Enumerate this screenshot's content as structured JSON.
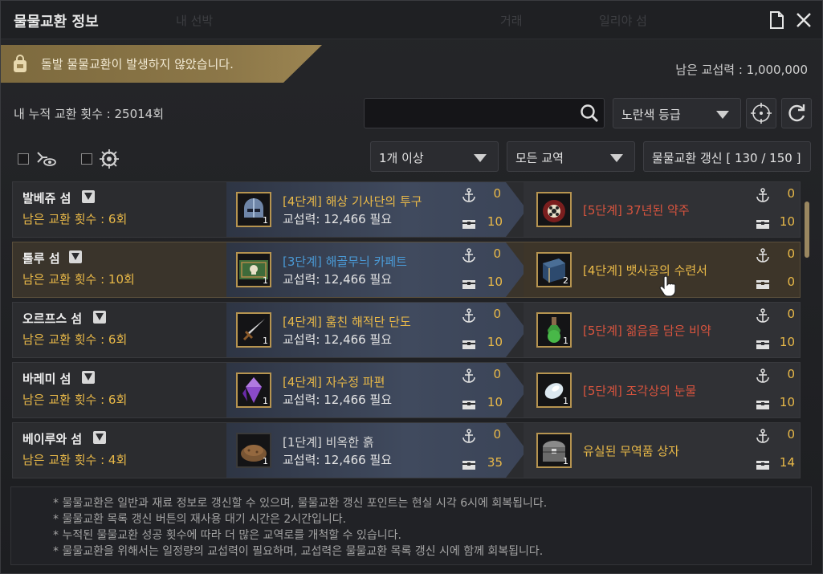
{
  "window": {
    "title": "물물교환 정보",
    "ghost_tabs": [
      "내 선박",
      "거래",
      "일리야 섬"
    ]
  },
  "banner": {
    "text": "돌발 물물교환이 발생하지 않았습니다."
  },
  "remaining_power": "남은 교섭력 : 1,000,000",
  "cumulative_count": "내 누적 교환 횟수 : 25014회",
  "search": {
    "value": ""
  },
  "grade_select": "노란색 등급",
  "quantity_select": "1개 이상",
  "zone_select": "모든 교역",
  "refresh_button": "물물교환 갱신 [ 130 / 150 ]",
  "rows": [
    {
      "island": "발베쥬 섬",
      "remain": "남은 교환 횟수 : 6회",
      "give": {
        "name": "[4단계] 해상 기사단의 투구",
        "grade": "gold",
        "cost": "교섭력: 12,466 필요",
        "count": "1",
        "icon": "helmet-icon",
        "anchor": "0",
        "chest": "10"
      },
      "get": {
        "name": "[5단계] 37년된 약주",
        "grade": "red",
        "count": "",
        "icon": "liquor-jar-icon",
        "anchor": "0",
        "chest": "10"
      }
    },
    {
      "island": "툴루 섬",
      "remain": "남은 교환 횟수 : 10회",
      "give": {
        "name": "[3단계] 해골무늬 카페트",
        "grade": "blue",
        "cost": "교섭력: 12,466 필요",
        "count": "1",
        "icon": "skull-carpet-icon",
        "anchor": "0",
        "chest": "10"
      },
      "get": {
        "name": "[4단계] 뱃사공의 수련서",
        "grade": "gold",
        "count": "2",
        "icon": "book-icon",
        "anchor": "0",
        "chest": "0"
      }
    },
    {
      "island": "오르프스 섬",
      "remain": "남은 교환 횟수 : 6회",
      "give": {
        "name": "[4단계] 훔친 해적단 단도",
        "grade": "gold",
        "cost": "교섭력: 12,466 필요",
        "count": "1",
        "icon": "dagger-icon",
        "anchor": "0",
        "chest": "10"
      },
      "get": {
        "name": "[5단계] 젊음을 담은 비약",
        "grade": "red",
        "count": "1",
        "icon": "potion-icon",
        "anchor": "0",
        "chest": "10"
      }
    },
    {
      "island": "바레미 섬",
      "remain": "남은 교환 횟수 : 6회",
      "give": {
        "name": "[4단계] 자수정 파편",
        "grade": "gold",
        "cost": "교섭력: 12,466 필요",
        "count": "1",
        "icon": "amethyst-icon",
        "anchor": "0",
        "chest": "10"
      },
      "get": {
        "name": "[5단계] 조각상의 눈물",
        "grade": "red",
        "count": "1",
        "icon": "tear-gem-icon",
        "anchor": "0",
        "chest": "10"
      }
    },
    {
      "island": "베이루와 섬",
      "remain": "남은 교환 횟수 : 4회",
      "give": {
        "name": "[1단계] 비옥한 흙",
        "grade": "white",
        "cost": "교섭력: 12,466 필요",
        "count": "1",
        "icon": "soil-icon",
        "anchor": "0",
        "chest": "35"
      },
      "get": {
        "name": "유실된 무역품 상자",
        "grade": "gold",
        "count": "1",
        "icon": "trade-chest-icon",
        "anchor": "0",
        "chest": "14"
      }
    }
  ],
  "footer_notes": [
    "* 물물교환은 일반과 재료 정보로 갱신할 수 있으며, 물물교환 갱신 포인트는 현실 시각 6시에 회복됩니다.",
    "* 물물교환 목록 갱신 버튼의 재사용 대기 시간은 2시간입니다.",
    "* 누적된 물물교환 성공 횟수에 따라 더 많은 교역로를 개척할 수 있습니다.",
    "* 물물교환을 위해서는 일정량의 교섭력이 필요하며, 교섭력은 물물교환 목록 갱신 시에 함께 회복됩니다."
  ],
  "colors": {
    "gold": "#e9b948",
    "blue": "#4a9ad6",
    "red": "#d9543e",
    "white": "#d8d8d8",
    "frame": "#b69450"
  }
}
